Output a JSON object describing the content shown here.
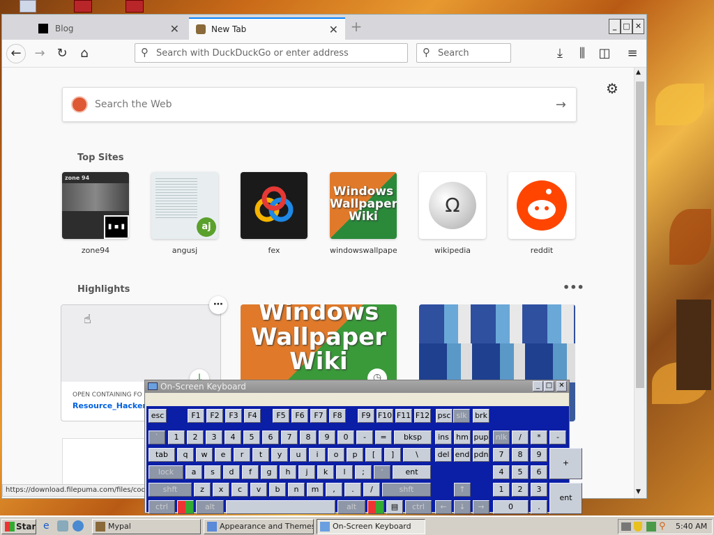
{
  "browser": {
    "tabs": [
      {
        "label": "Blog"
      },
      {
        "label": "New Tab"
      }
    ],
    "new_tab_glyph": "+",
    "window_controls": {
      "minimize": "_",
      "maximize": "□",
      "close": "✕"
    },
    "address": {
      "placeholder": "Search with DuckDuckGo or enter address"
    },
    "search": {
      "placeholder": "Search"
    },
    "status_url": "https://download.filepuma.com/files/codir"
  },
  "newtab": {
    "web_search": {
      "placeholder": "Search the Web"
    },
    "top_sites_heading": "Top Sites",
    "top_sites": [
      {
        "label": "zone94"
      },
      {
        "label": "angusj"
      },
      {
        "label": "fex"
      },
      {
        "label": "windowswallpaper..."
      },
      {
        "label": "wikipedia"
      },
      {
        "label": "reddit"
      }
    ],
    "highlights_heading": "Highlights",
    "highlight_card": {
      "context": "OPEN CONTAINING FO",
      "title": "Resource_Hacker_"
    },
    "wallpaper_words": [
      "Windows",
      "Wallpaper",
      "Wiki"
    ],
    "thumb_texts": {
      "zone94": "zone 94",
      "angusj_badge": "aj",
      "wikipedia_glyph": "Ω"
    }
  },
  "osk": {
    "title": "On-Screen Keyboard",
    "window_controls": {
      "minimize": "_",
      "maximize": "□",
      "close": "✕"
    },
    "keys": {
      "esc": "esc",
      "f1": "F1",
      "f2": "F2",
      "f3": "F3",
      "f4": "F4",
      "f5": "F5",
      "f6": "F6",
      "f7": "F7",
      "f8": "F8",
      "f9": "F9",
      "f10": "F10",
      "f11": "F11",
      "f12": "F12",
      "psc": "psc",
      "slk": "slk",
      "brk": "brk",
      "grave": "`",
      "n1": "1",
      "n2": "2",
      "n3": "3",
      "n4": "4",
      "n5": "5",
      "n6": "6",
      "n7": "7",
      "n8": "8",
      "n9": "9",
      "n0": "0",
      "minus": "-",
      "equals": "=",
      "bksp": "bksp",
      "ins": "ins",
      "hm": "hm",
      "pup": "pup",
      "nlk": "nlk",
      "kslash": "/",
      "kstar": "*",
      "kminus": "-",
      "tab": "tab",
      "q": "q",
      "w": "w",
      "e": "e",
      "r": "r",
      "t": "t",
      "y": "y",
      "u": "u",
      "i": "i",
      "o": "o",
      "p": "p",
      "lbr": "[",
      "rbr": "]",
      "bslash": "\\",
      "del": "del",
      "end": "end",
      "pdn": "pdn",
      "k7": "7",
      "k8": "8",
      "k9": "9",
      "kplus": "+",
      "lock": "lock",
      "a": "a",
      "s": "s",
      "d": "d",
      "f": "f",
      "g": "g",
      "h": "h",
      "j": "j",
      "k": "k",
      "l": "l",
      "semi": ";",
      "quote": "'",
      "ent": "ent",
      "k4": "4",
      "k5": "5",
      "k6": "6",
      "lshft": "shft",
      "z": "z",
      "x": "x",
      "c": "c",
      "v": "v",
      "b": "b",
      "n": "n",
      "m": "m",
      "comma": ",",
      "period": ".",
      "slash": "/",
      "rshft": "shft",
      "up": "↑",
      "k1": "1",
      "k2": "2",
      "k3": "3",
      "kent": "ent",
      "lctrl": "ctrl",
      "lalt": "alt",
      "ralt": "alt",
      "rctrl": "ctrl",
      "left": "←",
      "down": "↓",
      "right": "→",
      "k0": "0",
      "kdot": "."
    }
  },
  "taskbar": {
    "start": "Start",
    "buttons": [
      {
        "label": "Mypal"
      },
      {
        "label": "Appearance and Themes"
      },
      {
        "label": "On-Screen Keyboard"
      }
    ],
    "clock": "5:40 AM"
  },
  "colors": {
    "tab_accent": "#0a84ff",
    "osk_board": "#0a1ea6",
    "reddit": "#ff4500",
    "highlight_link": "#0060df"
  }
}
